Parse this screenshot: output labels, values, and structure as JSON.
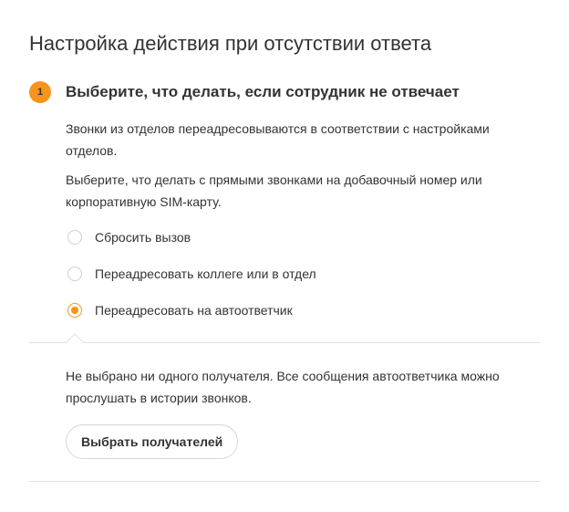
{
  "page": {
    "title": "Настройка действия при отсутствии ответа"
  },
  "step": {
    "number": "1",
    "title": "Выберите, что делать, если сотрудник не отвечает",
    "description_1": "Звонки из отделов переадресовываются в соответствии с настройками отделов.",
    "description_2": "Выберите, что делать с прямыми звонками на добавочный номер или корпоративную SIM-карту."
  },
  "options": [
    {
      "label": "Сбросить вызов",
      "checked": false
    },
    {
      "label": "Переадресовать коллеге или в отдел",
      "checked": false
    },
    {
      "label": "Переадресовать на автоответчик",
      "checked": true
    }
  ],
  "voicemail": {
    "info": "Не выбрано ни одного получателя. Все сообщения автоответчика можно прослушать в истории звонков.",
    "button_label": "Выбрать получателей"
  },
  "colors": {
    "accent": "#f7941d",
    "text": "#333333",
    "divider": "#e0e0e0"
  }
}
